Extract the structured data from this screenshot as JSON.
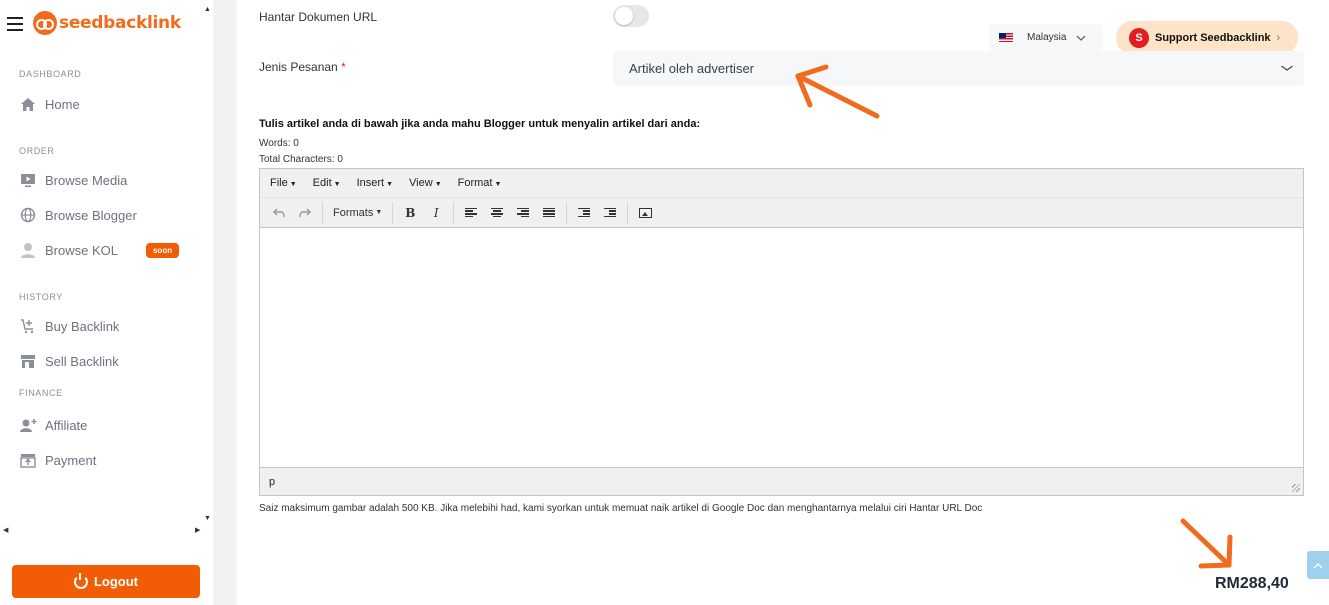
{
  "sidebar": {
    "logo_text": "seedbacklink",
    "sections": {
      "dashboard": "DASHBOARD",
      "order": "ORDER",
      "history": "HISTORY",
      "finance": "FINANCE"
    },
    "items": {
      "home": "Home",
      "browse_media": "Browse Media",
      "browse_blogger": "Browse Blogger",
      "browse_kol": "Browse KOL",
      "buy_backlink": "Buy Backlink",
      "sell_backlink": "Sell Backlink",
      "affiliate": "Affiliate",
      "payment": "Payment"
    },
    "kol_badge": "soon",
    "logout_label": "Logout"
  },
  "header": {
    "country": "Malaysia",
    "support_label": "Support Seedbacklink",
    "support_initial": "S"
  },
  "form": {
    "url_doc_label": "Hantar Dokumen URL",
    "url_doc_toggle": false,
    "order_type_label": "Jenis Pesanan",
    "order_type_required": "*",
    "order_type_value": "Artikel oleh advertiser",
    "instruction": "Tulis artikel anda di bawah jika anda mahu Blogger untuk menyalin artikel dari anda:",
    "words": "Words: 0",
    "characters": "Total Characters: 0"
  },
  "editor": {
    "menus": [
      "File",
      "Edit",
      "Insert",
      "View",
      "Format"
    ],
    "formats_label": "Formats",
    "bold": "B",
    "italic": "I",
    "status_path": "p"
  },
  "note": "Saiz maksimum gambar adalah 500 KB. Jika melebihi had, kami syorkan untuk memuat naik artikel di Google Doc dan menghantarnya melalui ciri Hantar URL Doc",
  "price": "RM288,40",
  "colors": {
    "brand": "#f26b1d",
    "logout": "#f25c05",
    "annotation_arrow": "#f26b1d"
  }
}
